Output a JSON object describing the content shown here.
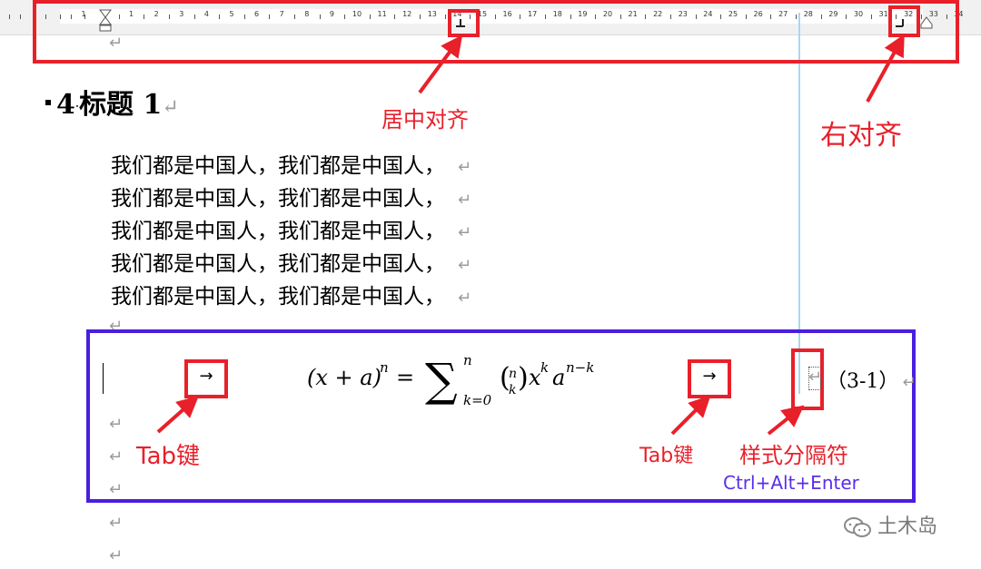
{
  "ruler": {
    "numbers": [
      "1",
      "2",
      "3",
      "4",
      "5",
      "6",
      "7",
      "8",
      "9",
      "10",
      "11",
      "12",
      "13",
      "14",
      "15",
      "16",
      "17",
      "18",
      "19",
      "20",
      "21",
      "22",
      "23",
      "24",
      "25",
      "26",
      "27",
      "28",
      "29",
      "30",
      "31",
      "32",
      "33",
      "34"
    ],
    "left_numbers": [
      "1"
    ]
  },
  "annotations": {
    "center_align": "居中对齐",
    "right_align": "右对齐",
    "tab_key_1": "Tab键",
    "tab_key_2": "Tab键",
    "style_separator": "样式分隔符",
    "shortcut": "Ctrl+Alt+Enter",
    "tab_arrow": "→"
  },
  "document": {
    "heading": {
      "number": "4",
      "text": "标题 1"
    },
    "body_lines": [
      "我们都是中国人，我们都是中国人，",
      "我们都是中国人，我们都是中国人，",
      "我们都是中国人，我们都是中国人，",
      "我们都是中国人，我们都是中国人，",
      "我们都是中国人，我们都是中国人，"
    ],
    "paragraph_mark": "↵",
    "equation_number": "（3-1）"
  },
  "watermark": {
    "text": "土木岛"
  },
  "colors": {
    "annotation_red": "#e8202a",
    "annotation_blue": "#4a1ee0",
    "guide_line": "#a8d8f0",
    "paragraph_mark": "#9b9b9b"
  }
}
